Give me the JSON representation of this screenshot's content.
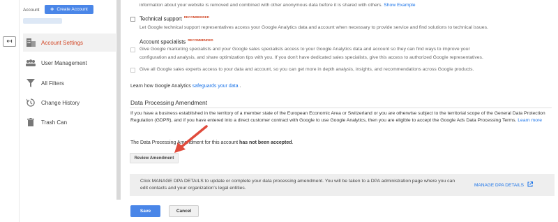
{
  "sidebar": {
    "account_label": "Account",
    "create_account": "Create Account",
    "items": [
      {
        "label": "Account Settings",
        "icon": "building-icon"
      },
      {
        "label": "User Management",
        "icon": "people-icon"
      },
      {
        "label": "All Filters",
        "icon": "filter-icon"
      },
      {
        "label": "Change History",
        "icon": "history-icon"
      },
      {
        "label": "Trash Can",
        "icon": "trash-icon"
      }
    ]
  },
  "sharing": {
    "intro_text": "information about your website is removed and combined with other anonymous data before it is shared with others.",
    "show_example": "Show Example",
    "tech_support": {
      "label": "Technical support",
      "badge": "RECOMMENDED",
      "description": "Let Google technical support representatives access your Google Analytics data and account when necessary to provide service and find solutions to technical issues."
    },
    "account_specialists": {
      "label": "Account specialists",
      "badge": "RECOMMENDED",
      "description_line1": "Give Google marketing specialists and your Google sales specialists access to your Google Analytics data and account so they can find ways to improve your",
      "description_line2": "configuration and analysis, and share optimization tips with you. If you don't have dedicated sales specialists, give this access to authorized Google representatives."
    },
    "all_sales_experts": "Give all Google sales experts access to your data and account, so you can get more in depth analysis, insights, and recommendations across Google products.",
    "learn_how": "Learn how Google Analytics",
    "safeguards_link": "safeguards your data",
    "learn_how_end": "."
  },
  "dpa": {
    "title": "Data Processing Amendment",
    "paragraph": "If you have a business established in the territory of a member state of the European Economic Area or Switzerland or you are otherwise subject to the territorial scope of the General Data Protection Regulation (GDPR), and if you have entered into a direct customer contract with Google to use Google Analytics, then you are eligible to accept the Google Ads Data Processing Terms.",
    "learn_more": "Learn more",
    "status_prefix": "The Data Processing Amendment for this account",
    "status_value": "has not been accepted",
    "status_suffix": ".",
    "review_button": "Review Amendment",
    "manage_text": "Click MANAGE DPA DETAILS to update or complete your data processing amendment. You will be taken to a DPA administration page where you can edit contacts and your organization's legal entities.",
    "manage_link": "MANAGE DPA DETAILS"
  },
  "footer": {
    "save": "Save",
    "cancel": "Cancel"
  },
  "colors": {
    "accent_blue": "#4a86e8",
    "active_red": "#d24726",
    "arrow_red": "#e04b3c"
  }
}
